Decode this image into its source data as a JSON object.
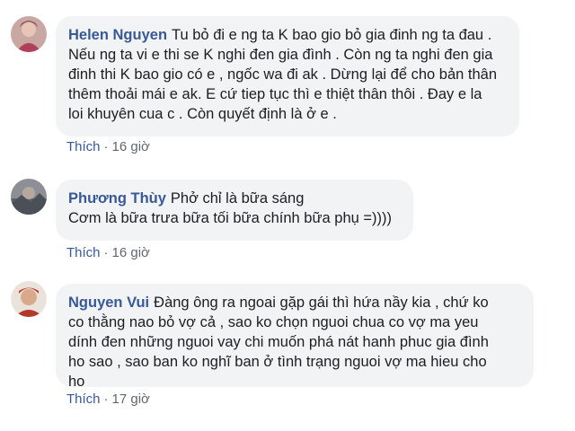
{
  "comments": [
    {
      "author": "Helen Nguyen",
      "lines": [
        "Tu bỏ đi e ng ta K bao gio bỏ gia đinh ng ta đau .",
        "Nếu ng ta vi e thi se K nghi đen gia đình . Còn ng ta nghi đen gia",
        "đinh thi K bao gio có e , ngốc wa đi ak . Dừng lại để cho bản thân",
        "thêm thoải mái e ak. E cứ tiep tục thì e thiệt thân thôi . Đay e la",
        "loi khuyên cua c . Còn quyết định là ở e ."
      ],
      "like_label": "Thích",
      "time": "16 giờ"
    },
    {
      "author": "Phương Thùy",
      "lines": [
        "Phở chỉ là bữa sáng",
        "Cơm là bữa trưa bữa tối bữa chính bữa phụ =))))"
      ],
      "like_label": "Thích",
      "time": "16 giờ"
    },
    {
      "author": "Nguyen Vui",
      "lines": [
        "Đàng ông ra ngoai gặp gái thì hứa nầy kia , chứ ko",
        "co thằng nao bỏ vợ cả , sao ko chọn nguoi chua co vợ ma yeu",
        "dính đen những nguoi vay chi muốn phá nát hanh phuc gia đình",
        "ho sao , sao ban ko nghĩ ban ở tình trạng nguoi vợ ma hieu cho",
        "ho"
      ],
      "like_label": "Thích",
      "time": "17 giờ"
    }
  ],
  "separator": "·",
  "colors": {
    "author": "#385898",
    "bubble": "#f2f3f5",
    "meta": "#606770",
    "text": "#1c1e21"
  }
}
